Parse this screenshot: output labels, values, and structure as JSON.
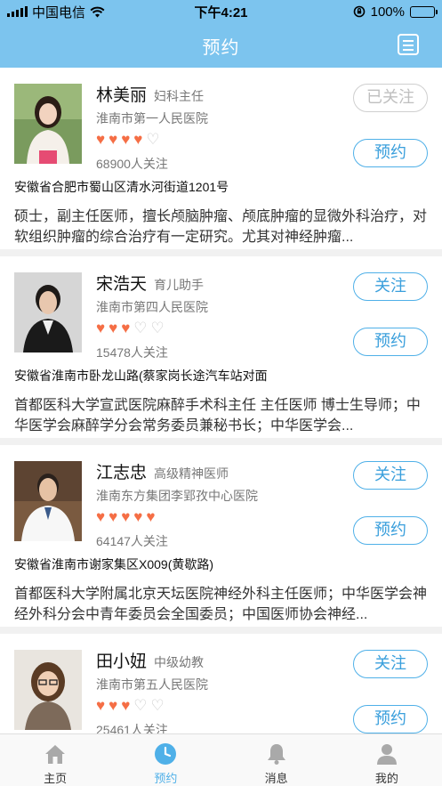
{
  "status_bar": {
    "carrier": "中国电信",
    "time": "下午4:21",
    "battery": "100%"
  },
  "nav": {
    "title": "预约",
    "menu_icon": "list-menu-icon"
  },
  "colors": {
    "header": "#7cc4ee",
    "accent": "#4fb0e8",
    "heart": "#f56e45"
  },
  "doctors": [
    {
      "name": "林美丽",
      "title": "妇科主任",
      "hospital": "淮南市第一人民医院",
      "rating": 4,
      "max_rating": 5,
      "followers": "68900人关注",
      "follow_label": "已关注",
      "followed": true,
      "book_label": "预约",
      "address": "安徽省合肥市蜀山区清水河街道1201号",
      "description": "硕士，副主任医师，擅长颅脑肿瘤、颅底肿瘤的显微外科治疗，对软组织肿瘤的综合治疗有一定研究。尤其对神经肿瘤..."
    },
    {
      "name": "宋浩天",
      "title": "育儿助手",
      "hospital": "淮南市第四人民医院",
      "rating": 3,
      "max_rating": 5,
      "followers": "15478人关注",
      "follow_label": "关注",
      "followed": false,
      "book_label": "预约",
      "address": "安徽省淮南市卧龙山路(蔡家岗长途汽车站对面",
      "description": "首都医科大学宣武医院麻醉手术科主任 主任医师 博士生导师；中华医学会麻醉学分会常务委员兼秘书长；中华医学会..."
    },
    {
      "name": "江志忠",
      "title": "高级精神医师",
      "hospital": "淮南东方集团李郢孜中心医院",
      "rating": 5,
      "max_rating": 5,
      "followers": "64147人关注",
      "follow_label": "关注",
      "followed": false,
      "book_label": "预约",
      "address": "安徽省淮南市谢家集区X009(黄歇路)",
      "description": "首都医科大学附属北京天坛医院神经外科主任医师；中华医学会神经外科分会中青年委员会全国委员；中国医师协会神经..."
    },
    {
      "name": "田小妞",
      "title": "中级幼教",
      "hospital": "淮南市第五人民医院",
      "rating": 3,
      "max_rating": 5,
      "followers": "25461人关注",
      "follow_label": "关注",
      "followed": false,
      "book_label": "预约",
      "address": "",
      "description": ""
    }
  ],
  "tabs": [
    {
      "label": "主页",
      "icon": "home-icon",
      "active": false
    },
    {
      "label": "预约",
      "icon": "clock-icon",
      "active": true
    },
    {
      "label": "消息",
      "icon": "bell-icon",
      "active": false
    },
    {
      "label": "我的",
      "icon": "person-icon",
      "active": false
    }
  ]
}
